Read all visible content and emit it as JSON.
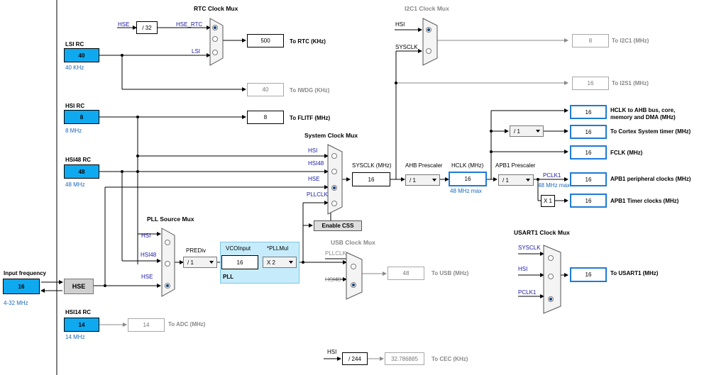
{
  "sources": {
    "lsi": {
      "name": "LSI RC",
      "value": "40",
      "freq": "40 KHz"
    },
    "hsi": {
      "name": "HSI RC",
      "value": "8",
      "freq": "8 MHz"
    },
    "hsi48": {
      "name": "HSI48 RC",
      "value": "48",
      "freq": "48 MHz"
    },
    "hsi14": {
      "name": "HSI14 RC",
      "value": "14",
      "freq": "14 MHz"
    },
    "input": {
      "label": "Input frequency",
      "value": "16",
      "range": "4-32 MHz"
    },
    "hse": {
      "name": "HSE"
    }
  },
  "rtc": {
    "title": "RTC Clock Mux",
    "hse_label": "HSE",
    "div": "/ 32",
    "hse_rtc": "HSE_RTC",
    "lsi": "LSI",
    "out_value": "500",
    "out_label": "To RTC (KHz)"
  },
  "iwdg": {
    "value": "40",
    "label": "To IWDG (KHz)"
  },
  "flitf": {
    "value": "8",
    "label": "To FLITF (MHz)"
  },
  "i2c1": {
    "title": "I2C1 Clock Mux",
    "hsi": "HSI",
    "sysclk": "SYSCLK",
    "value": "8",
    "label": "To I2C1 (MHz)"
  },
  "i2s1": {
    "value": "16",
    "label": "To I2S1 (MHz)"
  },
  "sysmux": {
    "title": "System Clock Mux",
    "hsi": "HSI",
    "hsi48": "HSI48",
    "hse": "HSE",
    "pllclk": "PLLCLK",
    "sysclk_label": "SYSCLK (MHz)",
    "sysclk_value": "16",
    "css": "Enable CSS"
  },
  "ahb": {
    "label": "AHB Prescaler",
    "value": "/ 1"
  },
  "hclk": {
    "label": "HCLK (MHz)",
    "value": "16",
    "max": "48 MHz max"
  },
  "apb1": {
    "label": "APB1 Prescaler",
    "value": "/ 1",
    "pclk1": "PCLK1",
    "max": "48 MHz max"
  },
  "outputs": {
    "hclk_ahb": {
      "value": "16",
      "label_line1": "HCLK to AHB bus, core,",
      "label_line2": "memory and DMA (MHz)"
    },
    "cortex": {
      "div": "/ 1",
      "value": "16",
      "label": "To Cortex System timer (MHz)"
    },
    "fclk": {
      "value": "16",
      "label": "FCLK (MHz)"
    },
    "apb1_periph": {
      "value": "16",
      "label": "APB1 peripheral clocks (MHz)"
    },
    "apb1_timer": {
      "mult": "X 1",
      "value": "16",
      "label": "APB1 Timer clocks (MHz)"
    }
  },
  "pllsrc": {
    "title": "PLL Source Mux",
    "hsi": "HSI",
    "hsi48": "HSI48",
    "hse": "HSE"
  },
  "pll": {
    "prediv_label": "PREDiv",
    "prediv": "/ 1",
    "vco_label": "VCOInput",
    "vco_value": "16",
    "pllmul_label": "*PLLMul",
    "pllmul": "X 2",
    "name": "PLL"
  },
  "usb": {
    "title": "USB Clock Mux",
    "pllclk": "PLLCLK",
    "hsi48": "HSI48",
    "value": "48",
    "label": "To USB (MHz)"
  },
  "usart1": {
    "title": "USART1 Clock Mux",
    "sysclk": "SYSCLK",
    "hsi": "HSI",
    "pclk1": "PCLK1",
    "value": "16",
    "label": "To USART1 (MHz)"
  },
  "adc": {
    "value": "14",
    "label": "To ADC (MHz)"
  },
  "cec": {
    "hsi": "HSI",
    "div": "/ 244",
    "value": "32.786885",
    "label": "To CEC (KHz)"
  }
}
